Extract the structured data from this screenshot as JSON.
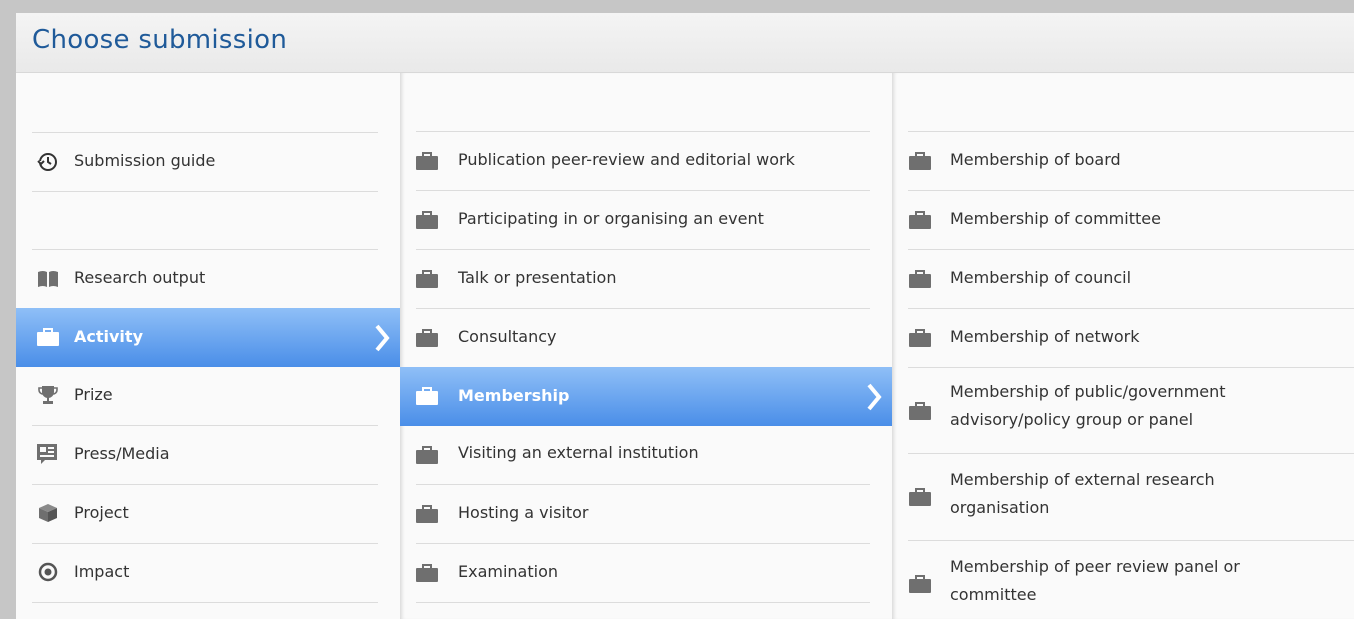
{
  "dialog": {
    "title": "Choose submission"
  },
  "colors": {
    "title": "#1f5a99",
    "active_top": "#8fbff7",
    "active_bottom": "#4a8ee8",
    "icon": "#6f6f6f"
  },
  "col1": {
    "items": [
      {
        "label": "Submission guide",
        "icon": "history-icon"
      },
      {
        "label": "Research output",
        "icon": "book-icon"
      },
      {
        "label": "Activity",
        "icon": "briefcase-icon",
        "selected": true
      },
      {
        "label": "Prize",
        "icon": "trophy-icon"
      },
      {
        "label": "Press/Media",
        "icon": "newspaper-icon"
      },
      {
        "label": "Project",
        "icon": "cube-icon"
      },
      {
        "label": "Impact",
        "icon": "target-icon"
      }
    ]
  },
  "col2": {
    "items": [
      {
        "label": "Publication peer-review and editorial work",
        "icon": "briefcase-icon"
      },
      {
        "label": "Participating in or organising an event",
        "icon": "briefcase-icon"
      },
      {
        "label": "Talk or presentation",
        "icon": "briefcase-icon"
      },
      {
        "label": "Consultancy",
        "icon": "briefcase-icon"
      },
      {
        "label": "Membership",
        "icon": "briefcase-icon",
        "selected": true
      },
      {
        "label": "Visiting an external institution",
        "icon": "briefcase-icon"
      },
      {
        "label": "Hosting a visitor",
        "icon": "briefcase-icon"
      },
      {
        "label": "Examination",
        "icon": "briefcase-icon"
      }
    ]
  },
  "col3": {
    "items": [
      {
        "label": "Membership of board",
        "icon": "briefcase-icon"
      },
      {
        "label": "Membership of committee",
        "icon": "briefcase-icon"
      },
      {
        "label": "Membership of council",
        "icon": "briefcase-icon"
      },
      {
        "label": "Membership of network",
        "icon": "briefcase-icon"
      },
      {
        "label": "Membership of public/government advisory/policy group or panel",
        "icon": "briefcase-icon"
      },
      {
        "label": "Membership of external research organisation",
        "icon": "briefcase-icon"
      },
      {
        "label": "Membership of peer review panel or committee",
        "icon": "briefcase-icon"
      }
    ]
  }
}
